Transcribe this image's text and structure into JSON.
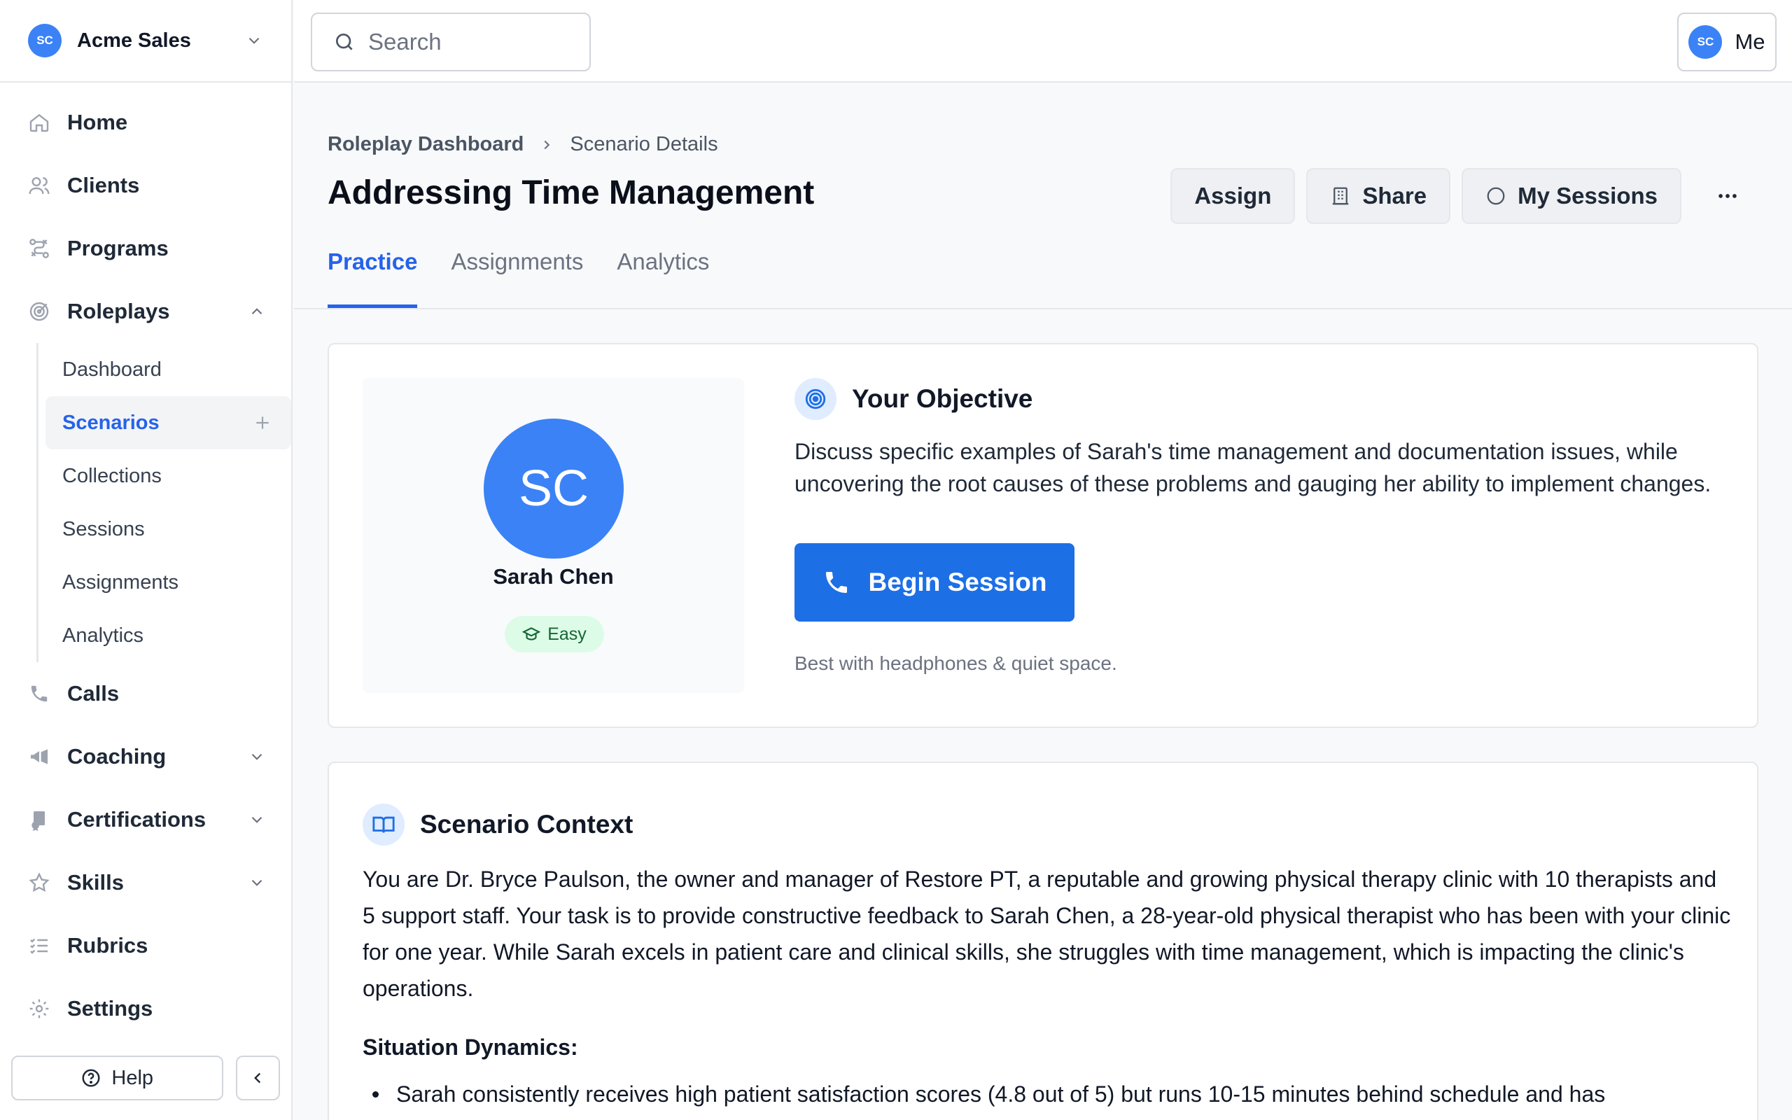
{
  "org": {
    "initials": "SC",
    "name": "Acme Sales"
  },
  "sidebar": {
    "items": [
      {
        "label": "Home",
        "icon": "home-icon"
      },
      {
        "label": "Clients",
        "icon": "users-icon"
      },
      {
        "label": "Programs",
        "icon": "programs-icon"
      },
      {
        "label": "Roleplays",
        "icon": "target-icon"
      }
    ],
    "roleplays_sub": [
      {
        "label": "Dashboard"
      },
      {
        "label": "Scenarios",
        "active": true
      },
      {
        "label": "Collections"
      },
      {
        "label": "Sessions"
      },
      {
        "label": "Assignments"
      },
      {
        "label": "Analytics"
      }
    ],
    "items_after": [
      {
        "label": "Calls",
        "icon": "phone-icon"
      },
      {
        "label": "Coaching",
        "icon": "megaphone-icon"
      },
      {
        "label": "Certifications",
        "icon": "certificate-icon"
      },
      {
        "label": "Skills",
        "icon": "star-icon"
      },
      {
        "label": "Rubrics",
        "icon": "list-icon"
      },
      {
        "label": "Settings",
        "icon": "gear-icon"
      }
    ],
    "help_label": "Help"
  },
  "topbar": {
    "search_placeholder": "Search",
    "user_initials": "SC",
    "user_label": "Me"
  },
  "breadcrumb": {
    "parent": "Roleplay Dashboard",
    "current": "Scenario Details"
  },
  "page_title": "Addressing Time Management",
  "actions": {
    "assign": "Assign",
    "share": "Share",
    "my_sessions": "My Sessions"
  },
  "tabs": [
    {
      "label": "Practice",
      "active": true
    },
    {
      "label": "Assignments"
    },
    {
      "label": "Analytics"
    }
  ],
  "persona": {
    "initials": "SC",
    "name": "Sarah Chen",
    "difficulty": "Easy"
  },
  "objective": {
    "title": "Your Objective",
    "text": "Discuss specific examples of Sarah's time management and documentation issues, while uncovering the root causes of these problems and gauging her ability to implement changes.",
    "begin_label": "Begin Session",
    "hint": "Best with headphones & quiet space."
  },
  "context": {
    "title": "Scenario Context",
    "text": "You are Dr. Bryce Paulson, the owner and manager of Restore PT, a reputable and growing physical therapy clinic with 10 therapists and 5 support staff. Your task is to provide constructive feedback to Sarah Chen, a 28-year-old physical therapist who has been with your clinic for one year. While Sarah excels in patient care and clinical skills, she struggles with time management, which is impacting the clinic's operations.",
    "dynamics_title": "Situation Dynamics:",
    "bullets": [
      "Sarah consistently receives high patient satisfaction scores (4.8 out of 5) but runs 10-15 minutes behind schedule and has"
    ]
  },
  "colors": {
    "accent": "#2563eb",
    "primary_button": "#1d6fe6",
    "avatar": "#3b82f6",
    "badge_bg": "#dcfce7",
    "badge_text": "#166534"
  }
}
